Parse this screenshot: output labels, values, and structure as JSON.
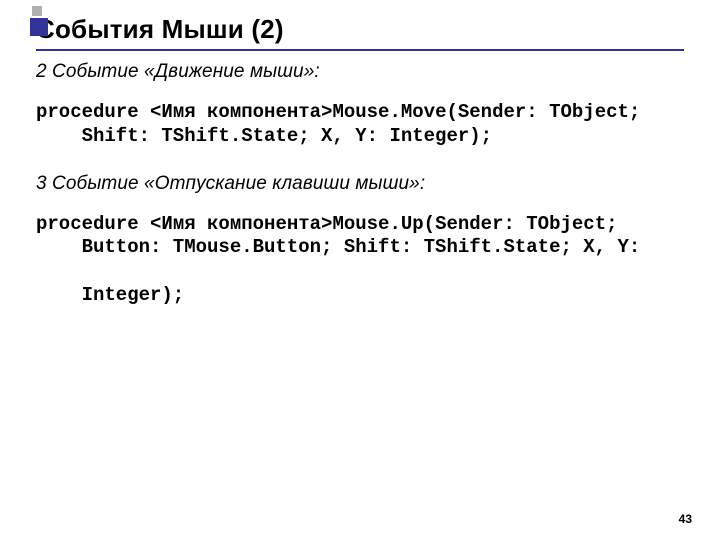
{
  "title": "События Мыши (2)",
  "subhead1": "2 Событие «Движение мыши»:",
  "code1_line1": "procedure <Имя компонента>Mouse.Move(Sender: TObject;",
  "code1_line2": "Shift: TShift.State; X, Y: Integer);",
  "subhead2": "3 Событие «Отпускание клавиши мыши»:",
  "code2_line1": "procedure <Имя компонента>Mouse.Up(Sender: TObject;",
  "code2_line2": "Button: TMouse.Button; Shift: TShift.State; X, Y:",
  "code2_line3": "Integer);",
  "pagenum": "43"
}
